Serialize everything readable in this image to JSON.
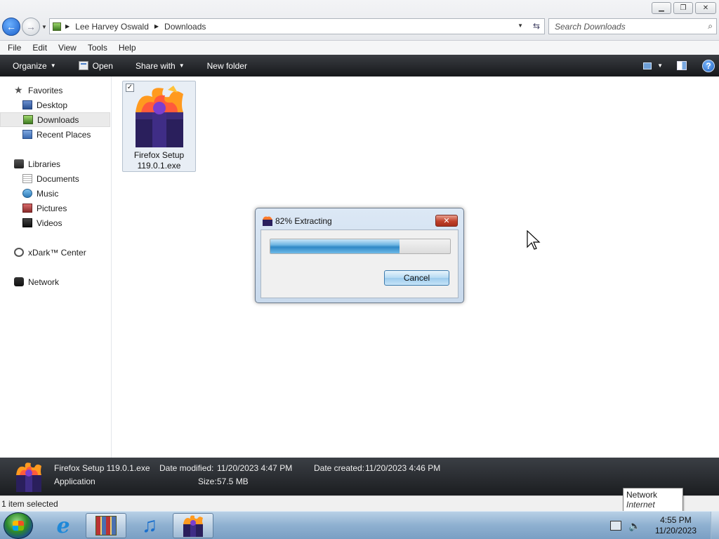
{
  "window": {
    "minimize_glyph": "▁",
    "maximize_glyph": "❐",
    "close_glyph": "✕"
  },
  "address_bar": {
    "breadcrumbs": [
      "Lee Harvey Oswald",
      "Downloads"
    ],
    "separator": "▶",
    "dropdown_glyph": "▼",
    "refresh_glyph": "⇆"
  },
  "search": {
    "placeholder": "Search Downloads",
    "icon": "search-icon"
  },
  "menu": [
    "File",
    "Edit",
    "View",
    "Tools",
    "Help"
  ],
  "toolbar": {
    "organize": "Organize",
    "open": "Open",
    "share_with": "Share with",
    "new_folder": "New folder",
    "help_glyph": "?"
  },
  "nav": {
    "favorites": "Favorites",
    "desktop": "Desktop",
    "downloads": "Downloads",
    "recent_places": "Recent Places",
    "libraries": "Libraries",
    "documents": "Documents",
    "music": "Music",
    "pictures": "Pictures",
    "videos": "Videos",
    "xdark": "xDark™ Center",
    "network": "Network"
  },
  "file": {
    "name_line1": "Firefox Setup",
    "name_line2": "119.0.1.exe",
    "checked_glyph": "✓"
  },
  "dialog": {
    "title": "82% Extracting",
    "progress_fraction": 0.72,
    "cancel_label": "Cancel",
    "close_glyph": "✕"
  },
  "details": {
    "file_name": "Firefox Setup 119.0.1.exe",
    "file_type": "Application",
    "date_modified_label": "Date modified:",
    "date_modified_value": "11/20/2023 4:47 PM",
    "size_label": "Size:",
    "size_value": "57.5 MB",
    "date_created_label": "Date created:",
    "date_created_value": "11/20/2023 4:46 PM"
  },
  "status": {
    "selection": "1 item selected"
  },
  "tooltip": {
    "title": "Network",
    "subtitle": "Internet access"
  },
  "taskbar": {
    "clock_time": "4:55 PM",
    "clock_date": "11/20/2023",
    "volume_glyph": "🔈"
  },
  "colors": {
    "accent": "#1c5fc9",
    "toolbar_bg": "#1f2124",
    "progress": "#2f88c6"
  }
}
